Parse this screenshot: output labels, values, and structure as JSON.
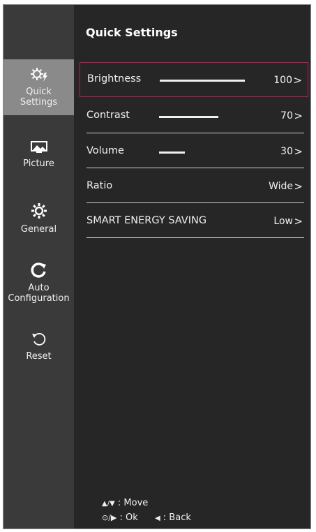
{
  "sidebar": {
    "items": [
      {
        "label": "Quick\nSettings",
        "icon": "quick-settings-icon",
        "active": true
      },
      {
        "label": "Picture",
        "icon": "picture-icon"
      },
      {
        "label": "General",
        "icon": "gear-icon"
      },
      {
        "label": "Auto\nConfiguration",
        "icon": "auto-config-icon"
      },
      {
        "label": "Reset",
        "icon": "reset-icon"
      }
    ]
  },
  "main": {
    "title": "Quick Settings",
    "rows": [
      {
        "label": "Brightness",
        "value": "100",
        "level": 1.0,
        "chevron": ">"
      },
      {
        "label": "Contrast",
        "value": "70",
        "level": 0.7,
        "chevron": ">"
      },
      {
        "label": "Volume",
        "value": "30",
        "level": 0.3,
        "chevron": ">"
      },
      {
        "label": "Ratio",
        "value": "Wide",
        "chevron": ">"
      },
      {
        "label": "SMART ENERGY SAVING",
        "value": "Low",
        "chevron": ">"
      }
    ]
  },
  "footer": {
    "move_glyph": "▲/▼",
    "move_label": ": Move",
    "ok_glyph": "⊙/▶",
    "ok_label": ": Ok",
    "back_glyph": "◀",
    "back_label": ": Back"
  },
  "colors": {
    "highlight": "#c2185b",
    "sidebar_active": "#8a8a8a"
  }
}
